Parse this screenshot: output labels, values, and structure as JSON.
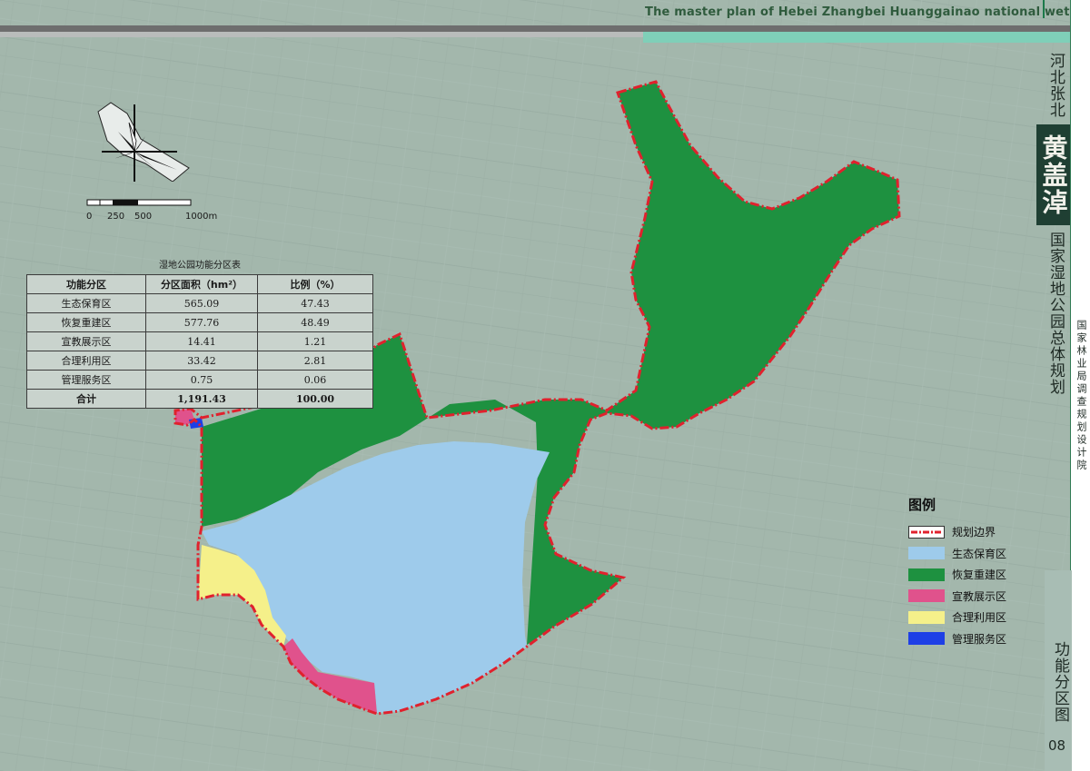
{
  "header": {
    "title": "The master plan of Hebei Zhangbei Huanggainao national wetland park"
  },
  "side_title": {
    "top": "河北张北",
    "logo": "黄盖淖",
    "bottom": "国家湿地公园总体规划"
  },
  "side_strip": {
    "text": "国家林业局调查规划设计院"
  },
  "page": {
    "sheet_title": "功能分区图",
    "number": "08"
  },
  "scale": {
    "labels": [
      "0",
      "250",
      "500",
      "1000m"
    ]
  },
  "table": {
    "title": "湿地公园功能分区表",
    "headers": [
      "功能分区",
      "分区面积（hm²）",
      "比例（%）"
    ],
    "rows": [
      [
        "生态保育区",
        "565.09",
        "47.43"
      ],
      [
        "恢复重建区",
        "577.76",
        "48.49"
      ],
      [
        "宣教展示区",
        "14.41",
        "1.21"
      ],
      [
        "合理利用区",
        "33.42",
        "2.81"
      ],
      [
        "管理服务区",
        "0.75",
        "0.06"
      ]
    ],
    "total": [
      "合计",
      "1,191.43",
      "100.00"
    ]
  },
  "legend": {
    "title": "图例",
    "items": [
      {
        "label": "规划边界",
        "color": "#e0212d",
        "kind": "boundary"
      },
      {
        "label": "生态保育区",
        "color": "#9ecbeb",
        "kind": "fill"
      },
      {
        "label": "恢复重建区",
        "color": "#1e9140",
        "kind": "fill"
      },
      {
        "label": "宣教展示区",
        "color": "#e0528c",
        "kind": "fill"
      },
      {
        "label": "合理利用区",
        "color": "#f5f08a",
        "kind": "fill"
      },
      {
        "label": "管理服务区",
        "color": "#1e3fe6",
        "kind": "fill"
      }
    ]
  },
  "colors": {
    "background": "#9fb3aa",
    "boundary": "#e0212d",
    "conservation": "#9ecbeb",
    "restoration": "#1e9140",
    "education": "#e0528c",
    "rational_use": "#f5f08a",
    "management": "#1e3fe6"
  }
}
